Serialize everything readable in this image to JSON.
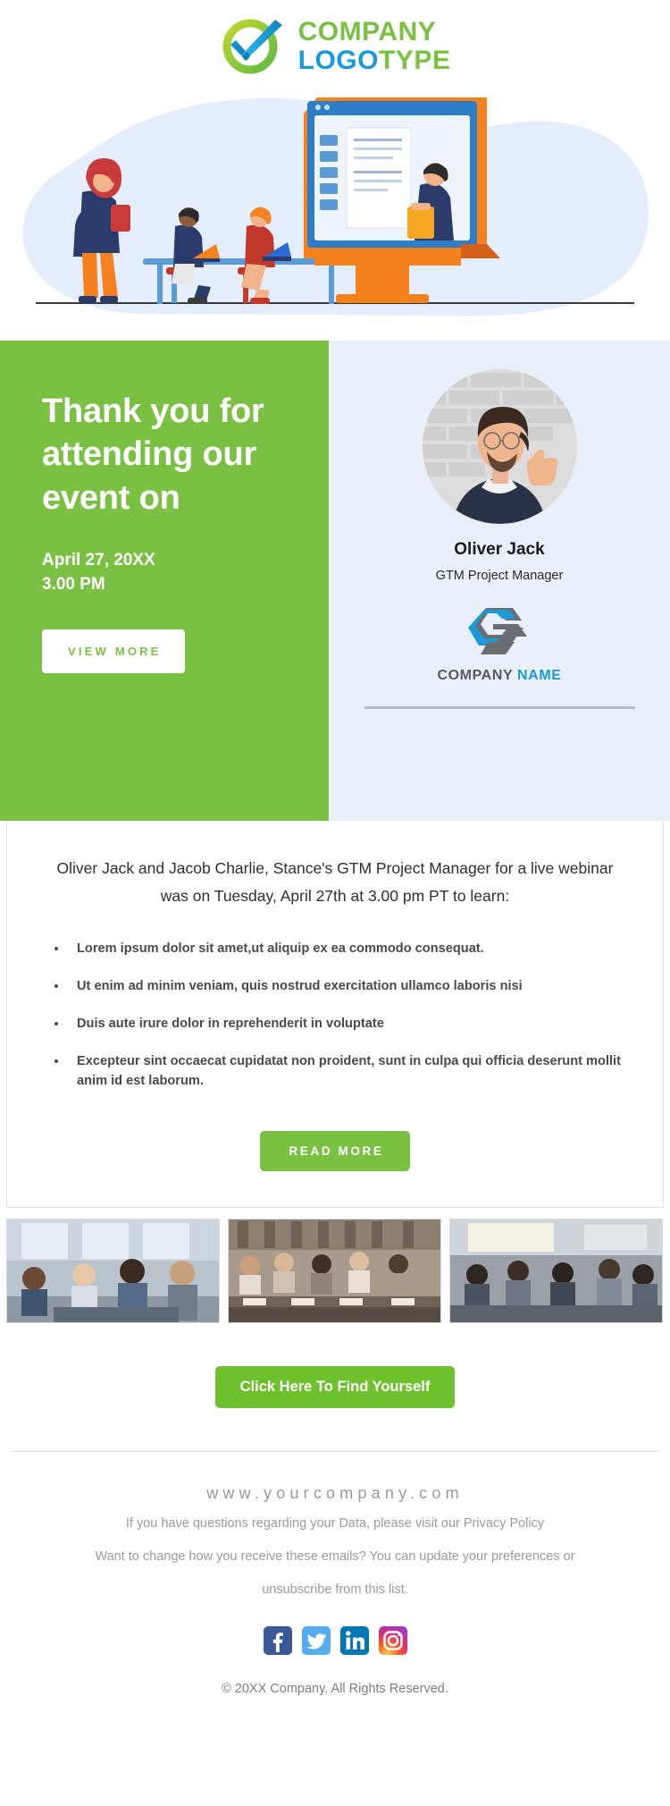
{
  "brand": {
    "logo_line1": "COMPANY",
    "logo_line2_bold": "LOGO",
    "logo_line2_light": "TYPE",
    "green": "#7ac143",
    "blue": "#1a9ad7"
  },
  "hero": {
    "heading": "Thank you for attending our event on",
    "date": "April 27, 20XX",
    "time": "3.00 PM",
    "view_more_label": "VIEW MORE"
  },
  "profile": {
    "name": "Oliver Jack",
    "role": "GTM Project Manager",
    "company_gray": "COMPANY",
    "company_blue": "NAME"
  },
  "body": {
    "lede": "Oliver Jack and Jacob Charlie, Stance's GTM Project Manager for a live webinar was on Tuesday, April 27th at 3.00 pm PT to learn:",
    "bullets": [
      "Lorem ipsum dolor sit amet,ut aliquip ex ea commodo consequat.",
      "Ut enim ad minim veniam, quis nostrud exercitation ullamco laboris nisi",
      "Duis aute irure dolor in reprehenderit in voluptate",
      "Excepteur sint occaecat cupidatat non proident, sunt in culpa qui officia deserunt mollit anim id est laborum."
    ],
    "read_more_label": "READ MORE"
  },
  "cta": {
    "label": "Click Here To Find Yourself"
  },
  "footer": {
    "site": "www.yourcompany.com",
    "line1": "If you have questions regarding your Data, please visit our Privacy Policy",
    "line2": "Want to change how you receive these emails? You can update your preferences or",
    "line3": "unsubscribe from this list.",
    "copyright": "© 20XX Company. All Rights Reserved.",
    "socials": [
      "facebook-icon",
      "twitter-icon",
      "linkedin-icon",
      "instagram-icon"
    ]
  }
}
